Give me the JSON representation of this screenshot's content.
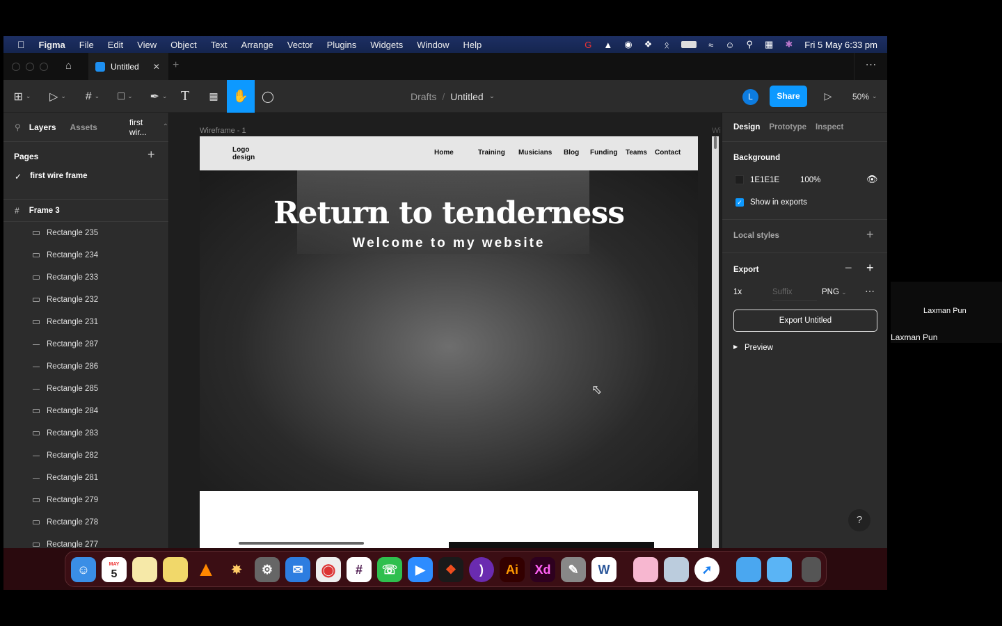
{
  "menubar": {
    "app": "Figma",
    "items": [
      "File",
      "Edit",
      "View",
      "Object",
      "Text",
      "Arrange",
      "Vector",
      "Plugins",
      "Widgets",
      "Window",
      "Help"
    ],
    "clock": "Fri 5 May  6:33 pm"
  },
  "tabbar": {
    "tab_title": "Untitled"
  },
  "toolbar": {
    "breadcrumb_root": "Drafts",
    "breadcrumb_sep": "/",
    "file_name": "Untitled",
    "avatar_initial": "L",
    "share_label": "Share",
    "zoom": "50%"
  },
  "left": {
    "tabs": {
      "layers": "Layers",
      "assets": "Assets"
    },
    "page_selector": "first wir...",
    "pages_title": "Pages",
    "current_page": "first wire frame",
    "frame": "Frame 3",
    "layers": [
      {
        "name": "Rectangle 235",
        "t": "rect"
      },
      {
        "name": "Rectangle 234",
        "t": "rect"
      },
      {
        "name": "Rectangle 233",
        "t": "rect"
      },
      {
        "name": "Rectangle 232",
        "t": "rect"
      },
      {
        "name": "Rectangle 231",
        "t": "rect"
      },
      {
        "name": "Rectangle 287",
        "t": "line"
      },
      {
        "name": "Rectangle 286",
        "t": "line"
      },
      {
        "name": "Rectangle 285",
        "t": "line"
      },
      {
        "name": "Rectangle 284",
        "t": "rect"
      },
      {
        "name": "Rectangle 283",
        "t": "rect"
      },
      {
        "name": "Rectangle 282",
        "t": "line"
      },
      {
        "name": "Rectangle 281",
        "t": "line"
      },
      {
        "name": "Rectangle 279",
        "t": "rect"
      },
      {
        "name": "Rectangle 278",
        "t": "rect"
      },
      {
        "name": "Rectangle 277",
        "t": "rect"
      }
    ]
  },
  "canvas": {
    "frame_label": "Wireframe - 1",
    "frame2_label": "Wi",
    "logo": [
      "Logo",
      "design"
    ],
    "nav": [
      "Home",
      "Training",
      "Musicians",
      "Blog",
      "Funding",
      "Teams",
      "Contact"
    ],
    "hero_title": "Return to tenderness",
    "hero_subtitle": "Welcome to my website"
  },
  "right": {
    "tabs": [
      "Design",
      "Prototype",
      "Inspect"
    ],
    "background_title": "Background",
    "bg_hex": "1E1E1E",
    "bg_opacity": "100%",
    "bg_color": "#1e1e1e",
    "show_in_exports": "Show in exports",
    "local_styles": "Local styles",
    "export_title": "Export",
    "export_scale": "1x",
    "suffix_placeholder": "Suffix",
    "format": "PNG",
    "export_button": "Export Untitled",
    "preview": "Preview",
    "help": "?"
  },
  "participant": {
    "name_small": "Laxman Pun",
    "name": "Laxman Pun"
  },
  "dock": {
    "calendar_month": "MAY",
    "calendar_day": "5",
    "ai": "Ai",
    "xd": "Xd"
  }
}
